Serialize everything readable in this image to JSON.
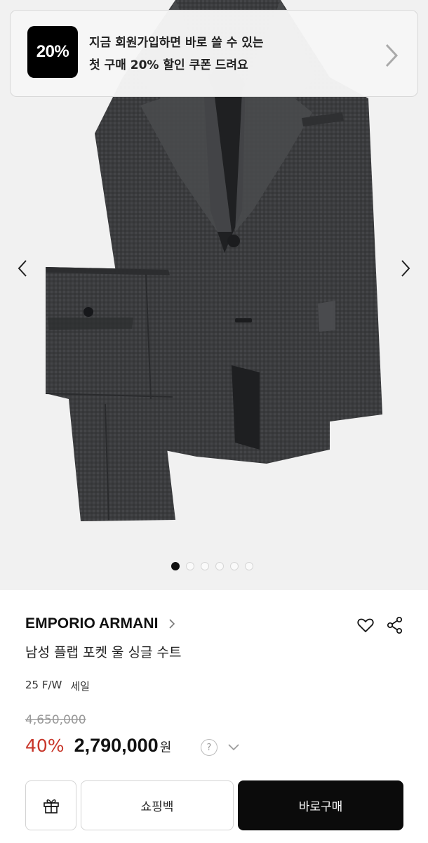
{
  "coupon": {
    "badge": "20%",
    "line1": "지금 회원가입하면 바로 쓸 수 있는",
    "line2": "첫 구매 20% 할인 쿠폰 드려요"
  },
  "carousel": {
    "slide_count": 6,
    "active_index": 0
  },
  "product": {
    "brand": "EMPORIO ARMANI",
    "name": "남성 플랩 포켓 울 싱글 수트",
    "season": "25 F/W",
    "sale_tag": "세일",
    "original_price": "4,650,000",
    "discount": "40%",
    "price": "2,790,000",
    "currency": "원",
    "help_symbol": "?"
  },
  "actions": {
    "bag_label": "쇼핑백",
    "buy_label": "바로구매"
  },
  "colors": {
    "discount": "#c8362a",
    "buy_button": "#0b0b0b"
  }
}
